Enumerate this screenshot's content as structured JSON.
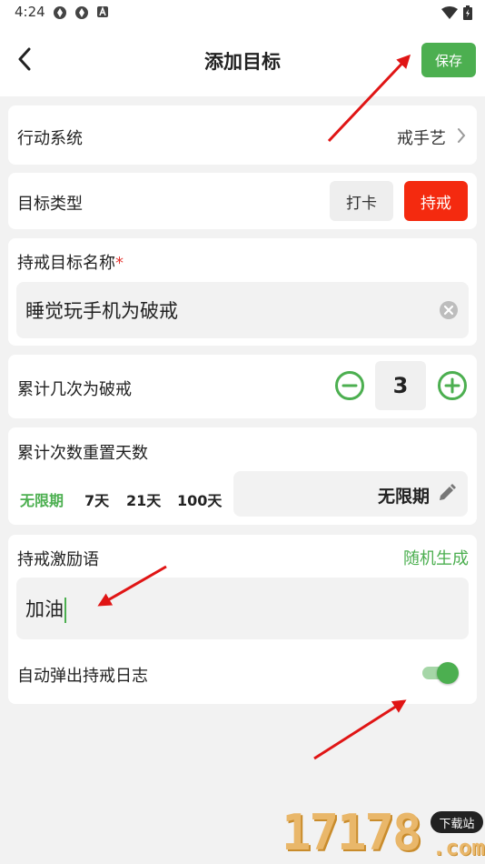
{
  "status_bar": {
    "time": "4:24"
  },
  "header": {
    "title": "添加目标",
    "save_label": "保存"
  },
  "action_system": {
    "label": "行动系统",
    "value": "戒手艺"
  },
  "goal_type": {
    "label": "目标类型",
    "options": [
      "打卡",
      "持戒"
    ],
    "selected": "持戒"
  },
  "goal_name": {
    "label": "持戒目标名称",
    "required_mark": "*",
    "value": "睡觉玩手机为破戒"
  },
  "break_count": {
    "label": "累计几次为破戒",
    "value": "3"
  },
  "reset_days": {
    "label": "累计次数重置天数",
    "options": [
      "无限期",
      "7天",
      "21天",
      "100天"
    ],
    "selected": "无限期",
    "display_value": "无限期"
  },
  "motivation": {
    "label": "持戒激励语",
    "random_label": "随机生成",
    "value": "加油"
  },
  "auto_popup": {
    "label": "自动弹出持戒日志",
    "enabled": true
  },
  "watermark": {
    "number": "17178",
    "badge": "下载站",
    "domain": ".com"
  },
  "colors": {
    "accent_green": "#4caf50",
    "active_red": "#f42a0f",
    "annotation_arrow": "#e01515"
  }
}
